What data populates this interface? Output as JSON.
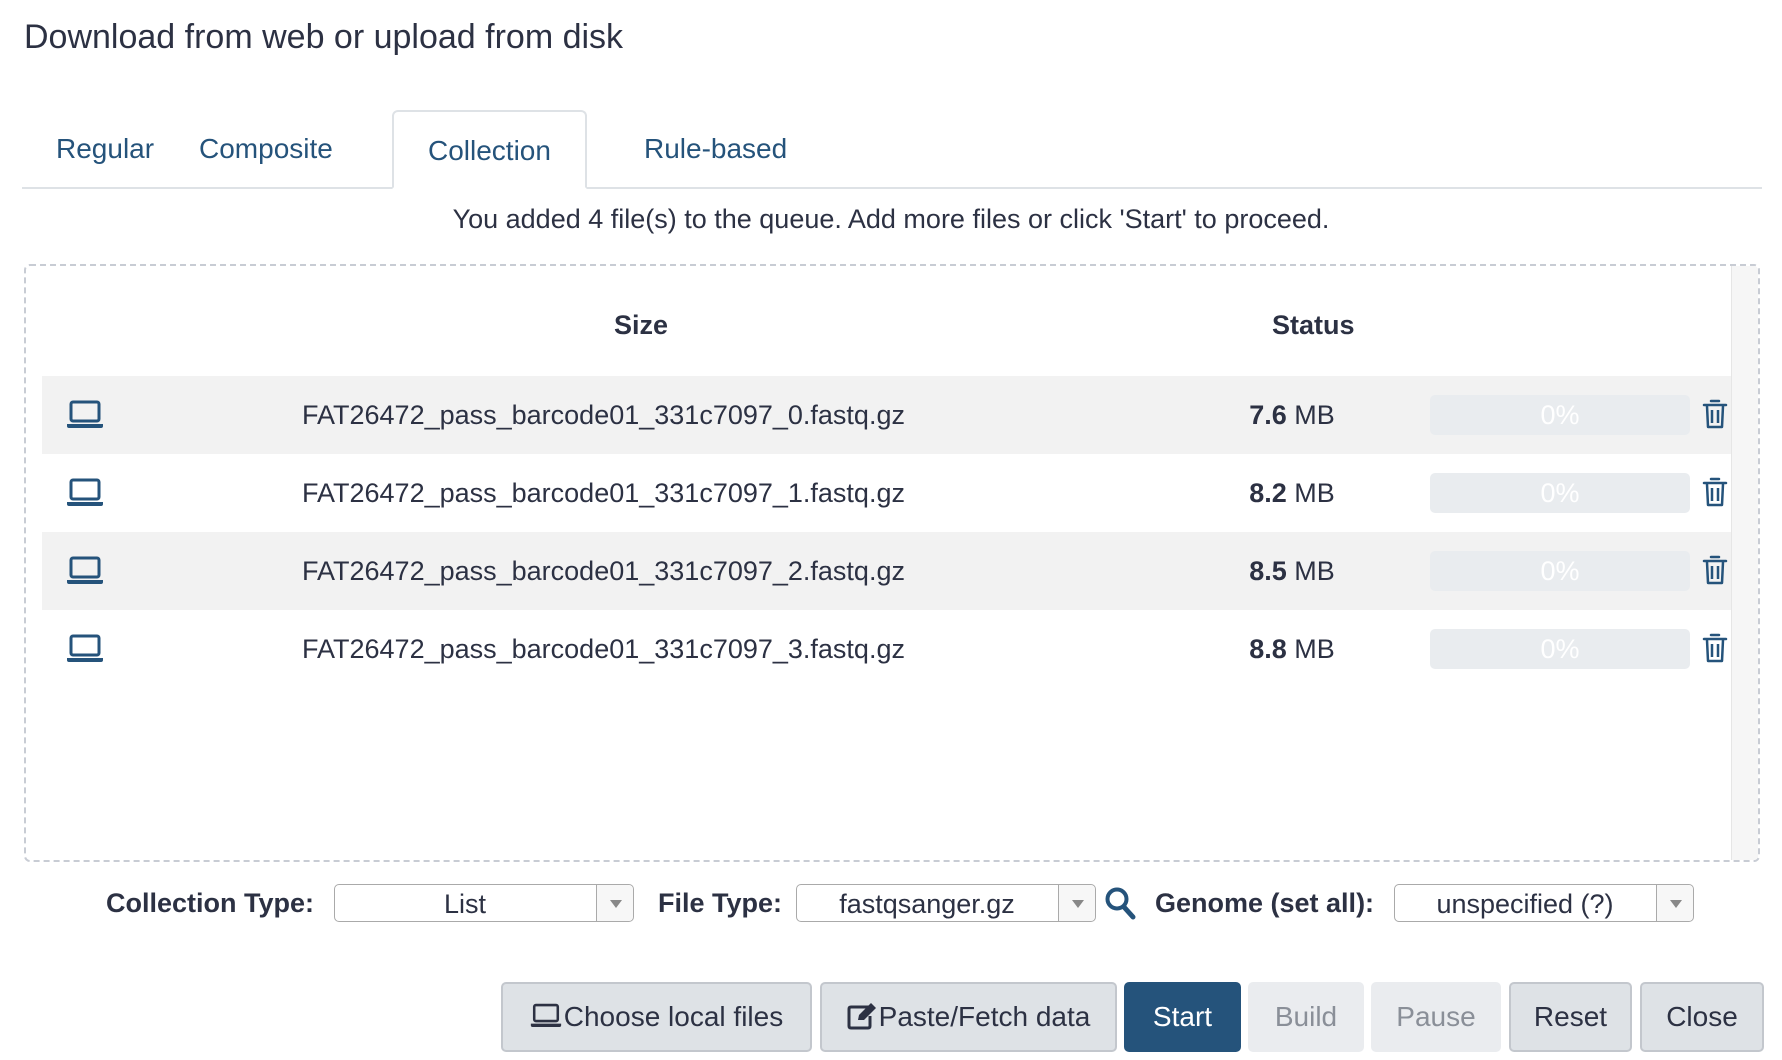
{
  "dialog": {
    "title": "Download from web or upload from disk"
  },
  "tabs": [
    {
      "label": "Regular",
      "active": false
    },
    {
      "label": "Composite",
      "active": false
    },
    {
      "label": "Collection",
      "active": true
    },
    {
      "label": "Rule-based",
      "active": false
    }
  ],
  "queue_message": "You added 4 file(s) to the queue. Add more files or click 'Start' to proceed.",
  "table": {
    "headers": {
      "size": "Size",
      "status": "Status"
    },
    "rows": [
      {
        "icon": "laptop-icon",
        "name": "FAT26472_pass_barcode01_331c7097_0.fastq.gz",
        "size_value": "7.6",
        "size_unit": "MB",
        "progress_label": "0%",
        "progress": 0
      },
      {
        "icon": "laptop-icon",
        "name": "FAT26472_pass_barcode01_331c7097_1.fastq.gz",
        "size_value": "8.2",
        "size_unit": "MB",
        "progress_label": "0%",
        "progress": 0
      },
      {
        "icon": "laptop-icon",
        "name": "FAT26472_pass_barcode01_331c7097_2.fastq.gz",
        "size_value": "8.5",
        "size_unit": "MB",
        "progress_label": "0%",
        "progress": 0
      },
      {
        "icon": "laptop-icon",
        "name": "FAT26472_pass_barcode01_331c7097_3.fastq.gz",
        "size_value": "8.8",
        "size_unit": "MB",
        "progress_label": "0%",
        "progress": 0
      }
    ]
  },
  "options": {
    "collection_type_label": "Collection Type:",
    "collection_type_value": "List",
    "file_type_label": "File Type:",
    "file_type_value": "fastqsanger.gz",
    "genome_label": "Genome (set all):",
    "genome_value": "unspecified (?)"
  },
  "buttons": {
    "choose_local": "Choose local files",
    "paste_fetch": "Paste/Fetch data",
    "start": "Start",
    "build": "Build",
    "pause": "Pause",
    "reset": "Reset",
    "close": "Close"
  },
  "colors": {
    "primary": "#25537b",
    "text": "#2c3143",
    "row_shade": "#f2f2f2"
  }
}
